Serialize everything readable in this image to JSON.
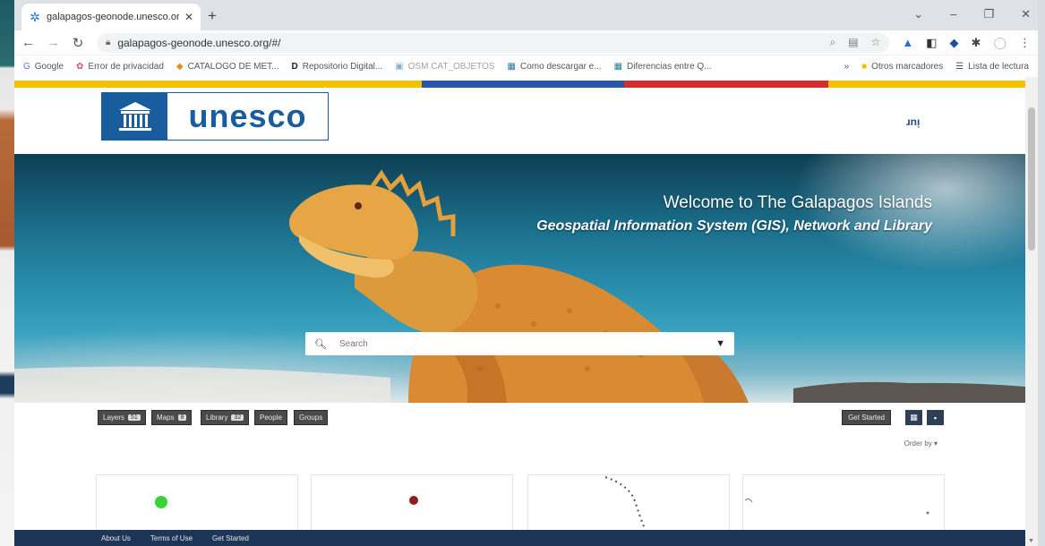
{
  "browser": {
    "tab_title": "galapagos-geonode.unesco.org",
    "tab_close": "✕",
    "new_tab": "+",
    "window_controls": [
      "⌄",
      "–",
      "❐",
      "✕"
    ],
    "url": "galapagos-geonode.unesco.org/#/",
    "bookmarks": [
      {
        "label": "Google",
        "icon": "G"
      },
      {
        "label": "Error de privacidad",
        "icon": "✿"
      },
      {
        "label": "CATALOGO DE MET...",
        "icon": "◆"
      },
      {
        "label": "Repositorio Digital...",
        "icon": "D"
      },
      {
        "label": "OSM CAT_OBJETOS",
        "icon": "▣"
      },
      {
        "label": "Como descargar e...",
        "icon": "▦"
      },
      {
        "label": "Diferencias entre Q...",
        "icon": "▦"
      }
    ],
    "bookmarks_overflow": "»",
    "other_bookmarks": "Otros marcadores",
    "reading_list": "Lista de lectura"
  },
  "site": {
    "logo_text": "unesco",
    "language": "ɹnᴉ"
  },
  "hero": {
    "title": "Welcome to The Galapagos Islands",
    "subtitle": "Geospatial Information System (GIS), Network and Library",
    "search_placeholder": "Search"
  },
  "filters": [
    {
      "label": "Layers",
      "count": "51"
    },
    {
      "label": "Maps",
      "count": "8"
    },
    {
      "label": "Library",
      "count": "32"
    },
    {
      "label": "People",
      "count": ""
    },
    {
      "label": "Groups",
      "count": ""
    }
  ],
  "get_started": "Get Started",
  "order_by": "Order by ▾",
  "footer": {
    "links": [
      "About Us",
      "Terms of Use",
      "Get Started"
    ]
  },
  "colors": {
    "accent_yellow": "#f2c200",
    "accent_blue": "#2857a4",
    "accent_red": "#d32f2f",
    "footer_navy": "#1d3557",
    "unesco_blue": "#1a5d9e"
  }
}
